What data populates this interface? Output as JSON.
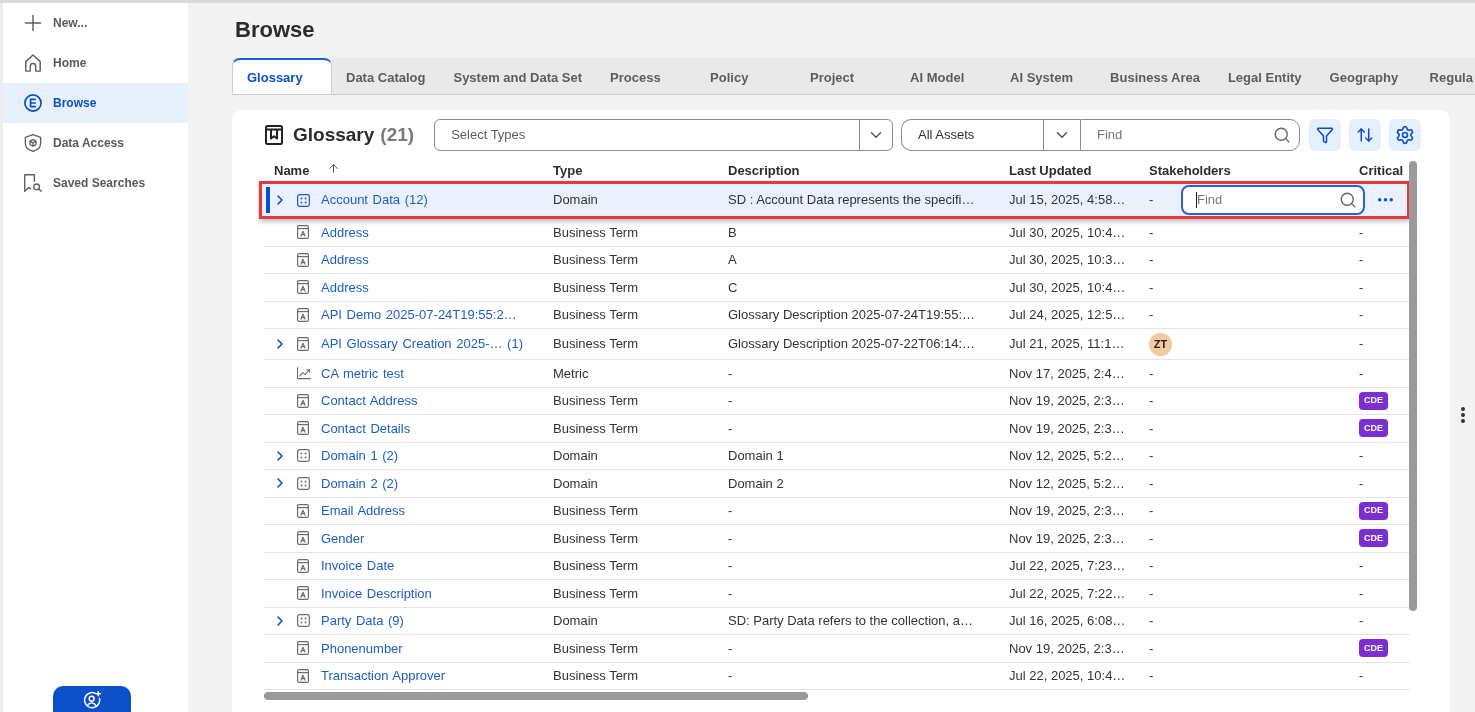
{
  "sidebar": {
    "items": [
      {
        "label": "New...",
        "selected": false
      },
      {
        "label": "Home",
        "selected": false
      },
      {
        "label": "Browse",
        "selected": true
      },
      {
        "label": "Data Access",
        "selected": false
      },
      {
        "label": "Saved Searches",
        "selected": false
      }
    ]
  },
  "page_title": "Browse",
  "tabs": [
    {
      "label": "Glossary",
      "selected": true
    },
    {
      "label": "Data Catalog",
      "selected": false
    },
    {
      "label": "System and Data Set",
      "selected": false
    },
    {
      "label": "Process",
      "selected": false
    },
    {
      "label": "Policy",
      "selected": false
    },
    {
      "label": "Project",
      "selected": false
    },
    {
      "label": "AI Model",
      "selected": false
    },
    {
      "label": "AI System",
      "selected": false
    },
    {
      "label": "Business Area",
      "selected": false
    },
    {
      "label": "Legal Entity",
      "selected": false
    },
    {
      "label": "Geography",
      "selected": false
    },
    {
      "label": "Regula",
      "selected": false
    }
  ],
  "panel": {
    "title": "Glossary",
    "count": "(21)",
    "type_select": {
      "placeholder": "Select Types"
    },
    "scope_select": {
      "value": "All Assets"
    },
    "search": {
      "placeholder": "Find"
    }
  },
  "table": {
    "columns": [
      {
        "label": "Name",
        "sorted": true
      },
      {
        "label": "Type",
        "sorted": false
      },
      {
        "label": "Description",
        "sorted": false
      },
      {
        "label": "Last Updated",
        "sorted": false
      },
      {
        "label": "Stakeholders",
        "sorted": false
      },
      {
        "label": "Critical",
        "sorted": false
      }
    ],
    "row_search": {
      "placeholder": "Find",
      "focused": true
    },
    "rows": [
      {
        "kind": "domain",
        "selected": true,
        "expandable": true,
        "name": "Account Data (12)",
        "type": "Domain",
        "description": "SD : Account Data represents the specifi…",
        "last_updated": "Jul 15, 2025, 4:58…",
        "stakeholders": {
          "text": "-",
          "avatar": false
        }
      },
      {
        "kind": "term",
        "selected": false,
        "expandable": false,
        "name": "Address",
        "type": "Business Term",
        "description": "B",
        "last_updated": "Jul 30, 2025, 10:4…",
        "stakeholders": {
          "text": "-",
          "avatar": false
        },
        "critical": {
          "text": "-",
          "badge": false
        }
      },
      {
        "kind": "term",
        "selected": false,
        "expandable": false,
        "name": "Address",
        "type": "Business Term",
        "description": "A",
        "last_updated": "Jul 30, 2025, 10:3…",
        "stakeholders": {
          "text": "-",
          "avatar": false
        },
        "critical": {
          "text": "-",
          "badge": false
        }
      },
      {
        "kind": "term",
        "selected": false,
        "expandable": false,
        "name": "Address",
        "type": "Business Term",
        "description": "C",
        "last_updated": "Jul 30, 2025, 10:4…",
        "stakeholders": {
          "text": "-",
          "avatar": false
        },
        "critical": {
          "text": "-",
          "badge": false
        }
      },
      {
        "kind": "term",
        "selected": false,
        "expandable": false,
        "name": "API Demo 2025-07-24T19:55:2…",
        "type": "Business Term",
        "description": "Glossary Description 2025-07-24T19:55:…",
        "last_updated": "Jul 24, 2025, 12:5…",
        "stakeholders": {
          "text": "-",
          "avatar": false
        },
        "critical": {
          "text": "-",
          "badge": false
        }
      },
      {
        "kind": "term",
        "selected": false,
        "expandable": true,
        "name": "API Glossary Creation 2025-… (1)",
        "type": "Business Term",
        "description": "Glossary Description 2025-07-22T06:14:…",
        "last_updated": "Jul 21, 2025, 11:1…",
        "stakeholders": {
          "text": "ZT",
          "avatar": true
        },
        "critical": {
          "text": "-",
          "badge": false
        }
      },
      {
        "kind": "metric",
        "selected": false,
        "expandable": false,
        "name": "CA metric test",
        "type": "Metric",
        "description": "-",
        "last_updated": "Nov 17, 2025, 2:4…",
        "stakeholders": {
          "text": "-",
          "avatar": false
        },
        "critical": {
          "text": "-",
          "badge": false
        }
      },
      {
        "kind": "term",
        "selected": false,
        "expandable": false,
        "name": "Contact Address",
        "type": "Business Term",
        "description": "-",
        "last_updated": "Nov 19, 2025, 2:3…",
        "stakeholders": {
          "text": "-",
          "avatar": false
        },
        "critical": {
          "text": "CDE",
          "badge": true
        }
      },
      {
        "kind": "term",
        "selected": false,
        "expandable": false,
        "name": "Contact Details",
        "type": "Business Term",
        "description": "-",
        "last_updated": "Nov 19, 2025, 2:3…",
        "stakeholders": {
          "text": "-",
          "avatar": false
        },
        "critical": {
          "text": "CDE",
          "badge": true
        }
      },
      {
        "kind": "domain",
        "selected": false,
        "expandable": true,
        "name": "Domain 1 (2)",
        "type": "Domain",
        "description": "Domain 1",
        "last_updated": "Nov 12, 2025, 5:2…",
        "stakeholders": {
          "text": "-",
          "avatar": false
        },
        "critical": {
          "text": "-",
          "badge": false
        }
      },
      {
        "kind": "domain",
        "selected": false,
        "expandable": true,
        "name": "Domain 2 (2)",
        "type": "Domain",
        "description": "Domain 2",
        "last_updated": "Nov 12, 2025, 5:2…",
        "stakeholders": {
          "text": "-",
          "avatar": false
        },
        "critical": {
          "text": "-",
          "badge": false
        }
      },
      {
        "kind": "term",
        "selected": false,
        "expandable": false,
        "name": "Email Address",
        "type": "Business Term",
        "description": "-",
        "last_updated": "Nov 19, 2025, 2:3…",
        "stakeholders": {
          "text": "-",
          "avatar": false
        },
        "critical": {
          "text": "CDE",
          "badge": true
        }
      },
      {
        "kind": "term",
        "selected": false,
        "expandable": false,
        "name": "Gender",
        "type": "Business Term",
        "description": "-",
        "last_updated": "Nov 19, 2025, 2:3…",
        "stakeholders": {
          "text": "-",
          "avatar": false
        },
        "critical": {
          "text": "CDE",
          "badge": true
        }
      },
      {
        "kind": "term",
        "selected": false,
        "expandable": false,
        "name": "Invoice Date",
        "type": "Business Term",
        "description": "-",
        "last_updated": "Jul 22, 2025, 7:23…",
        "stakeholders": {
          "text": "-",
          "avatar": false
        },
        "critical": {
          "text": "-",
          "badge": false
        }
      },
      {
        "kind": "term",
        "selected": false,
        "expandable": false,
        "name": "Invoice Description",
        "type": "Business Term",
        "description": "-",
        "last_updated": "Jul 22, 2025, 7:22…",
        "stakeholders": {
          "text": "-",
          "avatar": false
        },
        "critical": {
          "text": "-",
          "badge": false
        }
      },
      {
        "kind": "domain",
        "selected": false,
        "expandable": true,
        "name": "Party Data (9)",
        "type": "Domain",
        "description": "SD: Party Data refers to the collection, a…",
        "last_updated": "Jul 16, 2025, 6:08…",
        "stakeholders": {
          "text": "-",
          "avatar": false
        },
        "critical": {
          "text": "-",
          "badge": false
        }
      },
      {
        "kind": "term",
        "selected": false,
        "expandable": false,
        "name": "Phonenumber",
        "type": "Business Term",
        "description": "-",
        "last_updated": "Nov 19, 2025, 2:3…",
        "stakeholders": {
          "text": "-",
          "avatar": false
        },
        "critical": {
          "text": "CDE",
          "badge": true
        }
      },
      {
        "kind": "term",
        "selected": false,
        "expandable": false,
        "name": "Transaction Approver",
        "type": "Business Term",
        "description": "-",
        "last_updated": "Jul 22, 2025, 10:4…",
        "stakeholders": {
          "text": "-",
          "avatar": false
        },
        "critical": {
          "text": "-",
          "badge": false
        }
      }
    ]
  }
}
